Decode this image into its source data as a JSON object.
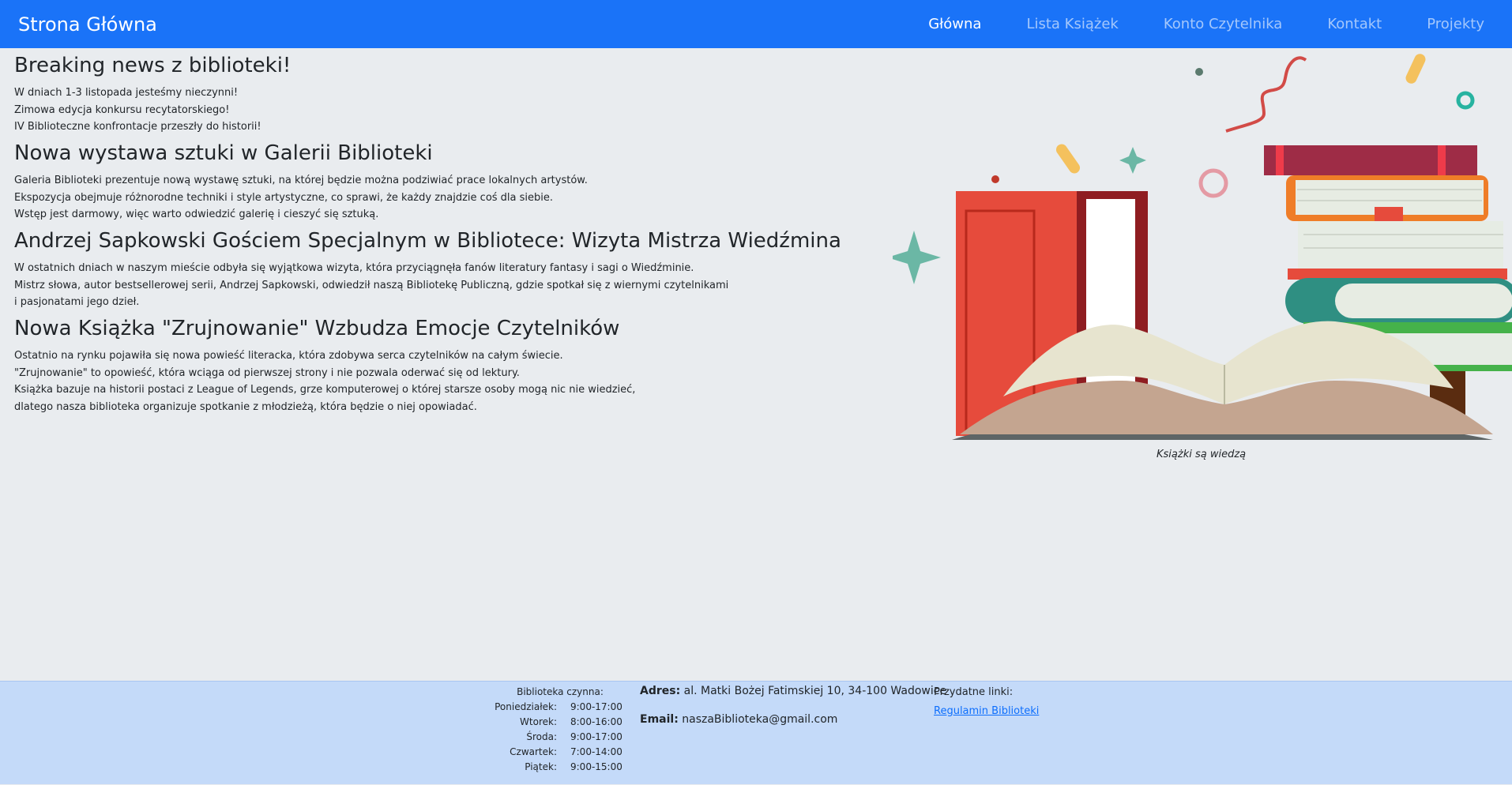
{
  "navbar": {
    "brand": "Strona Główna",
    "links": [
      {
        "label": "Główna",
        "active": true
      },
      {
        "label": "Lista Książek",
        "active": false
      },
      {
        "label": "Konto Czytelnika",
        "active": false
      },
      {
        "label": "Kontakt",
        "active": false
      },
      {
        "label": "Projekty",
        "active": false
      }
    ],
    "bg_color": "#1a73f8"
  },
  "articles": [
    {
      "title": "Breaking news z biblioteki!",
      "lines": [
        "W dniach 1-3 listopada jesteśmy nieczynni!",
        "Zimowa edycja konkursu recytatorskiego!",
        "IV Biblioteczne konfrontacje przeszły do historii!"
      ]
    },
    {
      "title": "Nowa wystawa sztuki w Galerii Biblioteki",
      "lines": [
        "Galeria Biblioteki prezentuje nową wystawę sztuki, na której będzie można podziwiać prace lokalnych artystów.",
        "Ekspozycja obejmuje różnorodne techniki i style artystyczne, co sprawi, że każdy znajdzie coś dla siebie.",
        "Wstęp jest darmowy, więc warto odwiedzić galerię i cieszyć się sztuką."
      ]
    },
    {
      "title": "Andrzej Sapkowski Gościem Specjalnym w Bibliotece: Wizyta Mistrza Wiedźmina",
      "lines": [
        "W ostatnich dniach w naszym mieście odbyła się wyjątkowa wizyta, która przyciągnęła fanów literatury fantasy i sagi o Wiedźminie.",
        "Mistrz słowa, autor bestsellerowej serii, Andrzej Sapkowski, odwiedził naszą Bibliotekę Publiczną, gdzie spotkał się z wiernymi czytelnikami",
        "i pasjonatami jego dzieł."
      ]
    },
    {
      "title": "Nowa Książka \"Zrujnowanie\" Wzbudza Emocje Czytelników",
      "lines": [
        "Ostatnio na rynku pojawiła się nowa powieść literacka, która zdobywa serca czytelników na całym świecie.",
        "\"Zrujnowanie\" to opowieść, która wciąga od pierwszej strony i nie pozwala oderwać się od lektury.",
        "Książka bazuje na historii postaci z League of Legends, grze komputerowej o której starsze osoby mogą nic nie wiedzieć,",
        "dlatego nasza biblioteka organizuje spotkanie z młodzieżą, która będzie o niej opowiadać."
      ]
    }
  ],
  "figure": {
    "caption": "Książki są wiedzą",
    "illustration": "books-illustration"
  },
  "footer": {
    "bg_color": "#c4daf9",
    "hours_title": "Biblioteka czynna:",
    "hours": [
      {
        "day": "Poniedziałek:",
        "time": "9:00-17:00"
      },
      {
        "day": "Wtorek:",
        "time": "8:00-16:00"
      },
      {
        "day": "Środa:",
        "time": "9:00-17:00"
      },
      {
        "day": "Czwartek:",
        "time": "7:00-14:00"
      },
      {
        "day": "Piątek:",
        "time": "9:00-15:00"
      }
    ],
    "address_label": "Adres:",
    "address_value": "al. Matki Bożej Fatimskiej 10, 34-100 Wadowice",
    "email_label": "Email:",
    "email_value": "naszaBiblioteka@gmail.com",
    "links_title": "Przydatne linki:",
    "links": [
      {
        "label": "Regulamin Biblioteki"
      }
    ]
  }
}
